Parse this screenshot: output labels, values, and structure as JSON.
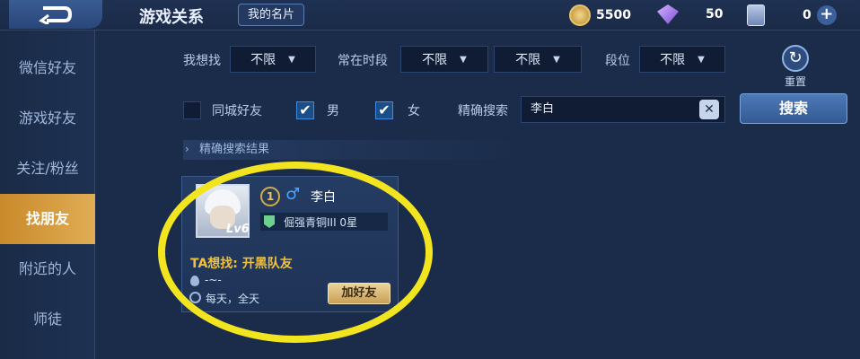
{
  "header": {
    "title": "游戏关系",
    "my_card_label": "我的名片",
    "currencies": [
      {
        "icon": "gold-coin-icon",
        "value": "5500"
      },
      {
        "icon": "diamond-icon",
        "value": "50"
      },
      {
        "icon": "ticket-icon",
        "value": "0"
      }
    ]
  },
  "sidebar": {
    "items": [
      {
        "label": "微信好友",
        "active": false
      },
      {
        "label": "游戏好友",
        "active": false
      },
      {
        "label": "关注/粉丝",
        "active": false
      },
      {
        "label": "找朋友",
        "active": true
      },
      {
        "label": "附近的人",
        "active": false
      },
      {
        "label": "师徒",
        "active": false
      }
    ]
  },
  "filters": {
    "want_label": "我想找",
    "want_value": "不限",
    "time_label": "常在时段",
    "time_value_1": "不限",
    "time_value_2": "不限",
    "rank_label": "段位",
    "rank_value": "不限",
    "reset_label": "重置",
    "same_city_label": "同城好友",
    "same_city_checked": false,
    "male_label": "男",
    "male_checked": true,
    "female_label": "女",
    "female_checked": true,
    "exact_search_label": "精确搜索",
    "search_value": "李白",
    "search_button": "搜索"
  },
  "results": {
    "header": "精确搜索结果",
    "card": {
      "rank_number": "1",
      "name": "李白",
      "level": "Lv6",
      "rank": "倔强青铜III 0星",
      "looking_for": "TA想找: 开黑队友",
      "location": "-~-",
      "time": "每天，全天",
      "add_button": "加好友"
    }
  },
  "colors": {
    "accent": "#e0ad55",
    "highlight": "#f2e51f"
  }
}
